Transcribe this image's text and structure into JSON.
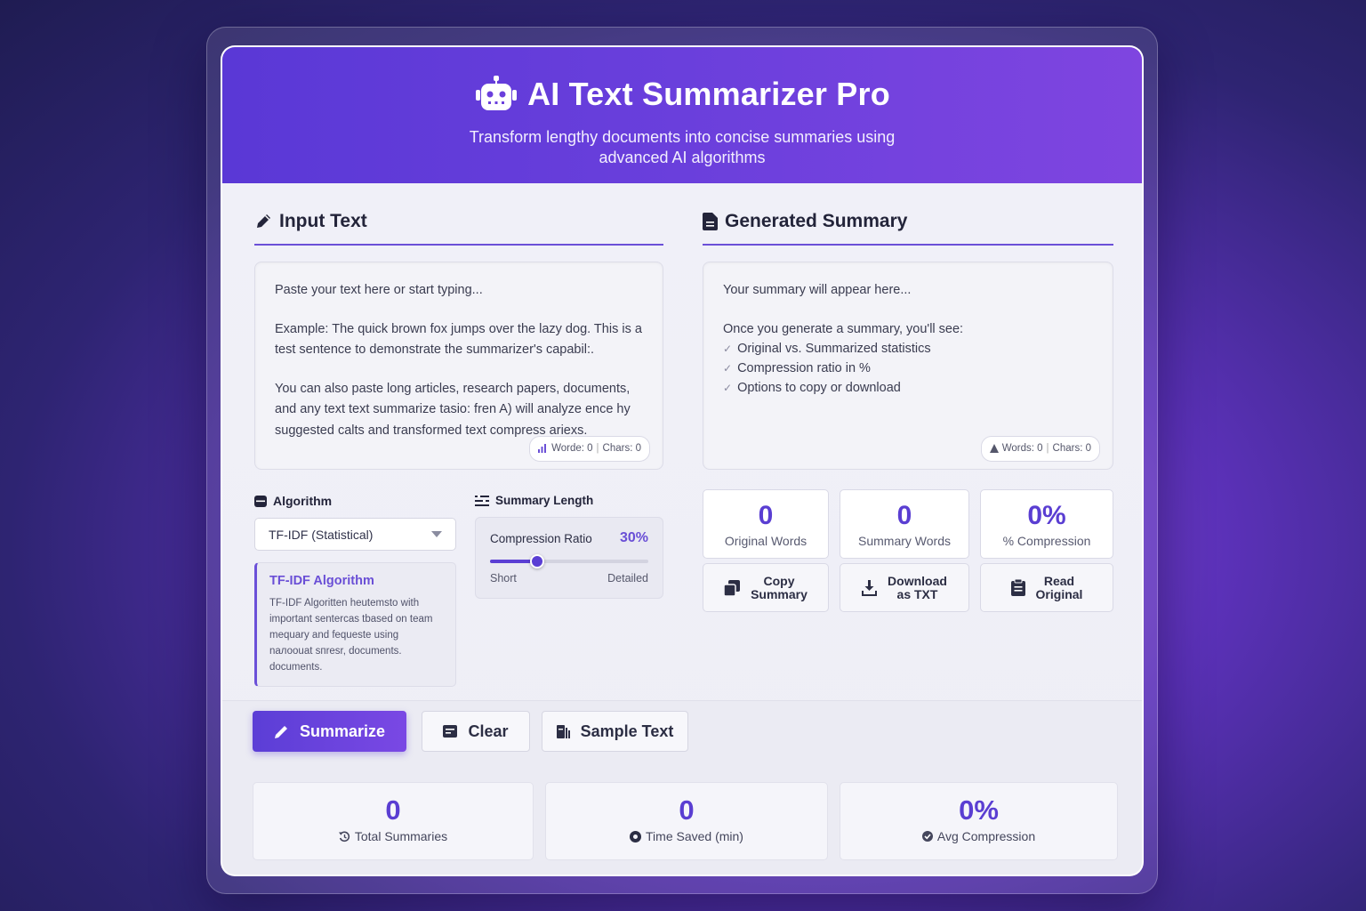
{
  "header": {
    "title": "AI Text Summarizer Pro",
    "subtitle_line1": "Transform lengthy documents into concise summaries using",
    "subtitle_line2": "advanced AI algorithms",
    "icon": "robot-icon"
  },
  "input": {
    "section_title": "Input Text",
    "placeholder_line": "Paste your text here or start typing...",
    "example": "Example: The quick brown fox jumps over the lazy dog. This is a test sentence to demonstrate the summarizer's capabil:.",
    "paragraph": "You can also paste long articles, research papers, documents, and any text text summarize tasio: fren A) will analyze ence hy suggested calts and transformed text compress ariexs.",
    "counter_words": "Worde: 0",
    "counter_chars": "Chars: 0"
  },
  "summary": {
    "section_title": "Generated Summary",
    "placeholder_line": "Your summary will appear here...",
    "intro": "Once you generate a summary, you'll see:",
    "features": [
      "Original vs. Summarized statistics",
      "Compression ratio in %",
      "Options to copy or download"
    ],
    "counter_words": "Words: 0",
    "counter_chars": "Chars: 0"
  },
  "algorithm": {
    "label": "Algorithm",
    "selected": "TF-IDF (Statistical)",
    "info_title": "TF-IDF Algorithm",
    "info_text": "TF-IDF Algoritten heutemsto with important sentercas tbased on team mequary and fequeste using nалоouat sпresr, documents. documents."
  },
  "length": {
    "label": "Summary Length",
    "ratio_label": "Compression Ratio",
    "ratio_value": "30%",
    "ratio_fraction": 0.3,
    "min_label": "Short",
    "max_label": "Detailed"
  },
  "stats": [
    {
      "value": "0",
      "label": "Original Words"
    },
    {
      "value": "0",
      "label": "Summary Words"
    },
    {
      "value": "0%",
      "label": "% Compression"
    }
  ],
  "actions": {
    "copy_line1": "Copy",
    "copy_line2": "Summary",
    "download_line1": "Download",
    "download_line2": "as TXT",
    "read_line1": "Read",
    "read_line2": "Original"
  },
  "buttons": {
    "summarize": "Summarize",
    "clear": "Clear",
    "sample": "Sample Text"
  },
  "totals": [
    {
      "value": "0",
      "label": "Total Summaries"
    },
    {
      "value": "0",
      "label": "Time Saved (min)"
    },
    {
      "value": "0%",
      "label": "Avg Compression"
    }
  ],
  "colors": {
    "accent": "#5a3ed2",
    "header_start": "#5a38d6",
    "header_end": "#7f45e0"
  }
}
